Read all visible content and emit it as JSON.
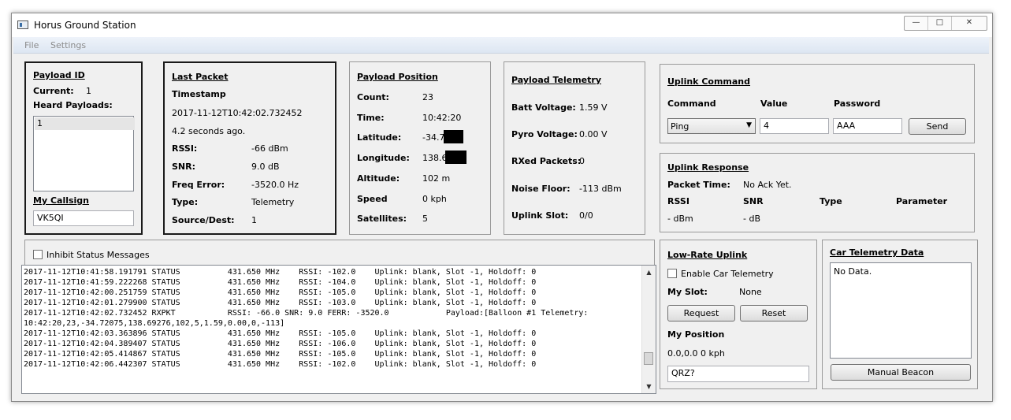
{
  "window": {
    "title": "Horus Ground Station"
  },
  "menu": [
    "File",
    "Settings"
  ],
  "payload_id": {
    "heading": "Payload ID",
    "current_label": "Current:",
    "current_value": "1",
    "heard_label": "Heard Payloads:",
    "heard_items": [
      "1"
    ],
    "callsign_heading": "My Callsign",
    "callsign_value": "VK5QI"
  },
  "last_packet": {
    "heading": "Last Packet",
    "timestamp_label": "Timestamp",
    "timestamp": "2017-11-12T10:42:02.732452",
    "age": "4.2 seconds ago.",
    "rows": [
      {
        "label": "RSSI:",
        "value": "-66 dBm"
      },
      {
        "label": "SNR:",
        "value": "9.0 dB"
      },
      {
        "label": "Freq Error:",
        "value": "-3520.0 Hz"
      },
      {
        "label": "Type:",
        "value": "Telemetry"
      },
      {
        "label": "Source/Dest:",
        "value": "1"
      }
    ]
  },
  "payload_position": {
    "heading": "Payload Position",
    "rows": [
      {
        "label": "Count:",
        "value": "23"
      },
      {
        "label": "Time:",
        "value": "10:42:20"
      },
      {
        "label": "Latitude:",
        "value": "-34.7"
      },
      {
        "label": "Longitude:",
        "value": "138.6"
      },
      {
        "label": "Altitude:",
        "value": "102 m"
      },
      {
        "label": "Speed",
        "value": "0 kph"
      },
      {
        "label": "Satellites:",
        "value": "5"
      }
    ]
  },
  "payload_telemetry": {
    "heading": "Payload Telemetry",
    "rows": [
      {
        "label": "Batt Voltage:",
        "value": "1.59 V"
      },
      {
        "label": "Pyro Voltage:",
        "value": "0.00 V"
      },
      {
        "label": "RXed Packets:",
        "value": "0"
      },
      {
        "label": "Noise Floor:",
        "value": "-113 dBm"
      },
      {
        "label": "Uplink Slot:",
        "value": "0/0"
      }
    ]
  },
  "uplink_command": {
    "heading": "Uplink Command",
    "command_label": "Command",
    "value_label": "Value",
    "password_label": "Password",
    "command_selected": "Ping",
    "value": "4",
    "password": "AAA",
    "send_label": "Send"
  },
  "uplink_response": {
    "heading": "Uplink Response",
    "packet_time_label": "Packet Time:",
    "packet_time": "No Ack Yet.",
    "columns": [
      "RSSI",
      "SNR",
      "Type",
      "Parameter"
    ],
    "values": [
      "- dBm",
      "- dB"
    ]
  },
  "status_log": {
    "inhibit_label": "Inhibit Status Messages",
    "lines": [
      "2017-11-12T10:41:58.191791 STATUS          431.650 MHz    RSSI: -102.0    Uplink: blank, Slot -1, Holdoff: 0",
      "2017-11-12T10:41:59.222268 STATUS          431.650 MHz    RSSI: -104.0    Uplink: blank, Slot -1, Holdoff: 0",
      "2017-11-12T10:42:00.251759 STATUS          431.650 MHz    RSSI: -105.0    Uplink: blank, Slot -1, Holdoff: 0",
      "2017-11-12T10:42:01.279900 STATUS          431.650 MHz    RSSI: -103.0    Uplink: blank, Slot -1, Holdoff: 0",
      "2017-11-12T10:42:02.732452 RXPKT           RSSI: -66.0 SNR: 9.0 FERR: -3520.0            Payload:[Balloon #1 Telemetry:",
      "10:42:20,23,-34.72075,138.69276,102,5,1.59,0.00,0,-113]",
      "2017-11-12T10:42:03.363896 STATUS          431.650 MHz    RSSI: -105.0    Uplink: blank, Slot -1, Holdoff: 0",
      "2017-11-12T10:42:04.389407 STATUS          431.650 MHz    RSSI: -106.0    Uplink: blank, Slot -1, Holdoff: 0",
      "2017-11-12T10:42:05.414867 STATUS          431.650 MHz    RSSI: -105.0    Uplink: blank, Slot -1, Holdoff: 0",
      "2017-11-12T10:42:06.442307 STATUS          431.650 MHz    RSSI: -102.0    Uplink: blank, Slot -1, Holdoff: 0"
    ]
  },
  "low_rate_uplink": {
    "heading": "Low-Rate Uplink",
    "enable_label": "Enable Car Telemetry",
    "slot_label": "My Slot:",
    "slot_value": "None",
    "request_label": "Request",
    "reset_label": "Reset",
    "position_label": "My Position",
    "position_value": "0.0,0.0 0 kph",
    "qrz_value": "QRZ?"
  },
  "car_telemetry": {
    "heading": "Car Telemetry Data",
    "text": "No Data.",
    "manual_beacon_label": "Manual Beacon"
  }
}
